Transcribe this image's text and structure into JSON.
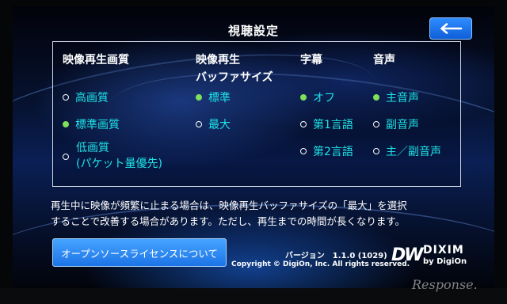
{
  "title": "視聴設定",
  "columns": [
    {
      "header": "映像再生画質",
      "header2": ""
    },
    {
      "header": "映像再生",
      "header2": "バッファサイズ"
    },
    {
      "header": "字幕",
      "header2": ""
    },
    {
      "header": "音声",
      "header2": ""
    }
  ],
  "quality_options": [
    {
      "label": "高画質",
      "selected": false
    },
    {
      "label": "標準画質",
      "selected": true
    },
    {
      "label": "低画質",
      "label2": "(パケット量優先)",
      "selected": false
    }
  ],
  "buffer_options": [
    {
      "label": "標準",
      "selected": true
    },
    {
      "label": "最大",
      "selected": false
    }
  ],
  "subtitle_options": [
    {
      "label": "オフ",
      "selected": true
    },
    {
      "label": "第1言語",
      "selected": false
    },
    {
      "label": "第2言語",
      "selected": false
    }
  ],
  "audio_options": [
    {
      "label": "主音声",
      "selected": true
    },
    {
      "label": "副音声",
      "selected": false
    },
    {
      "label": "主／副音声",
      "selected": false
    }
  ],
  "note": {
    "line1": "再生中に映像が頻繁に止まる場合は、映像再生バッファサイズの「最大」を選択",
    "line2": "することで改善する場合があります。ただし、再生までの時間が長くなります。"
  },
  "license_button": "オープンソースライセンスについて",
  "version": "バージョン　1.1.0 (1029)",
  "copyright": "Copyright © DigiOn, Inc. All rights reserved.",
  "logo": {
    "main": "DIXIM",
    "sub": "by DigiOn",
    "mark": "DW"
  },
  "watermark": "Response.",
  "colors": {
    "accent": "#1ee3e8",
    "selected_dot": "#7fe05a",
    "button": "#1c74e6"
  }
}
